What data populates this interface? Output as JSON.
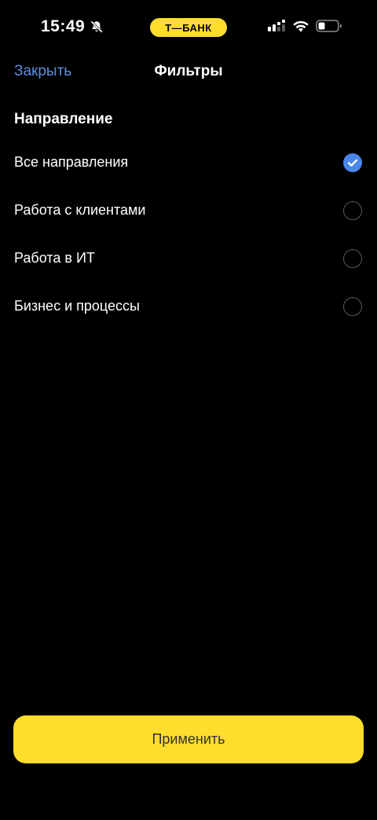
{
  "status_bar": {
    "time": "15:49",
    "carrier": "Т—БАНК",
    "icons": [
      "bell-off-icon",
      "signal-icon",
      "wifi-icon",
      "battery-icon"
    ]
  },
  "nav": {
    "close_label": "Закрыть",
    "title": "Фильтры"
  },
  "section": {
    "title": "Направление",
    "options": [
      {
        "label": "Все направления",
        "selected": true
      },
      {
        "label": "Работа с клиентами",
        "selected": false
      },
      {
        "label": "Работа в ИТ",
        "selected": false
      },
      {
        "label": "Бизнес и процессы",
        "selected": false
      }
    ]
  },
  "apply_label": "Применить",
  "colors": {
    "accent_yellow": "#ffdd2d",
    "link_blue": "#5b8fdf",
    "radio_selected": "#4a86ea",
    "background": "#000000"
  }
}
